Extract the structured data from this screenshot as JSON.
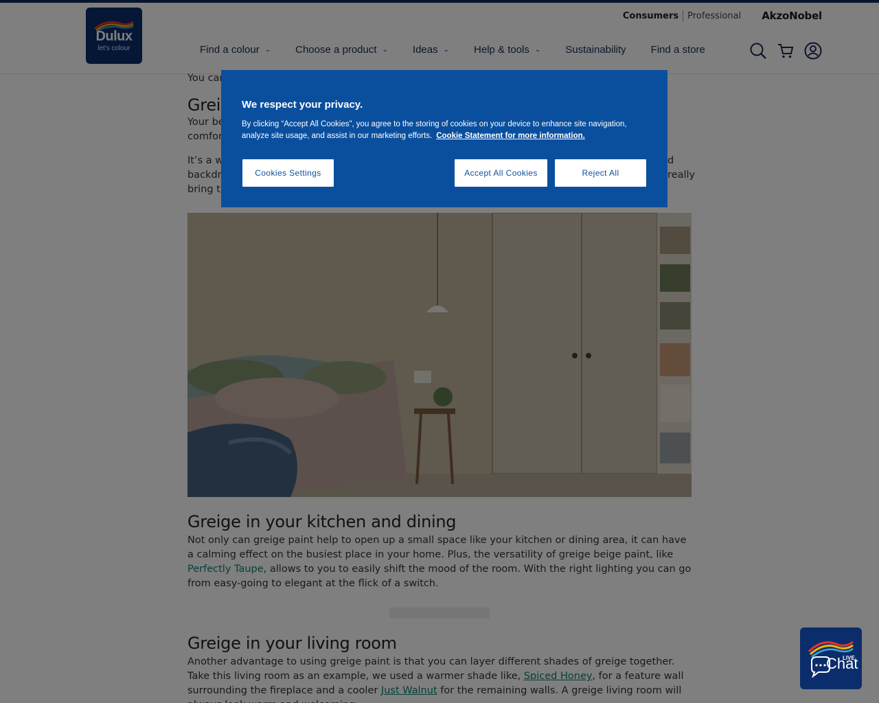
{
  "header": {
    "logo": {
      "word": "Dulux",
      "tagline": "let's colour"
    },
    "utility": {
      "consumers": "Consumers",
      "professional": "Professional",
      "brand": "AkzoNobel"
    },
    "nav": [
      {
        "label": "Find a colour",
        "has_dropdown": true
      },
      {
        "label": "Choose a product",
        "has_dropdown": true
      },
      {
        "label": "Ideas",
        "has_dropdown": true
      },
      {
        "label": "Help & tools",
        "has_dropdown": true
      },
      {
        "label": "Sustainability",
        "has_dropdown": false
      },
      {
        "label": "Find a store",
        "has_dropdown": false
      }
    ],
    "icons": [
      "search-icon",
      "cart-icon",
      "account-icon"
    ]
  },
  "content": {
    "partial_line": "You can",
    "partial_heading": "Greige",
    "partial_p1a": "Your be",
    "partial_p1b": "comfort",
    "partial_p2a": "It’s a wa",
    "partial_p2b": "backdro",
    "partial_p2c": "bring th",
    "partial_p2a_end": "d",
    "partial_p2b_end": "really",
    "kitchen": {
      "heading": "Greige in your kitchen and dining",
      "text_before": "Not only can greige paint help to open up a small space like your kitchen or dining area, it can have a calming effect on the busiest place in your home. Plus, the versatility of greige beige paint, like ",
      "link": "Perfectly Taupe",
      "text_after": ", allows to you to easily shift the mood of the room. With the right lighting you can go from easy-going to elegant at the flick of a switch."
    },
    "living": {
      "heading": "Greige in your living room",
      "text_before": "Another advantage to using greige paint is that you can layer different shades of greige together. Take this living room as an example, we used a warmer shade like, ",
      "link1": "Spiced Honey",
      "text_mid": ", for a feature wall surrounding the fireplace and a cooler ",
      "link2": "Just Walnut",
      "text_after": " for the remaining walls. A greige living room will always look warm and welcoming,"
    }
  },
  "cookie": {
    "title": "We respect your privacy.",
    "text": "By clicking “Accept All Cookies”, you agree to the storing of cookies on your device to enhance site navigation, analyze site usage, and assist in our marketing efforts.",
    "link": "Cookie Statement for more information.",
    "settings_label": "Cookies Settings",
    "accept_label": "Accept All Cookies",
    "reject_label": "Reject All"
  },
  "chat": {
    "label": "Chat",
    "badge": "LIVE"
  },
  "colors": {
    "brand_navy": "#0c2d6b",
    "cookie_blue": "#0a4f9e",
    "link_teal": "#0a7f71"
  }
}
